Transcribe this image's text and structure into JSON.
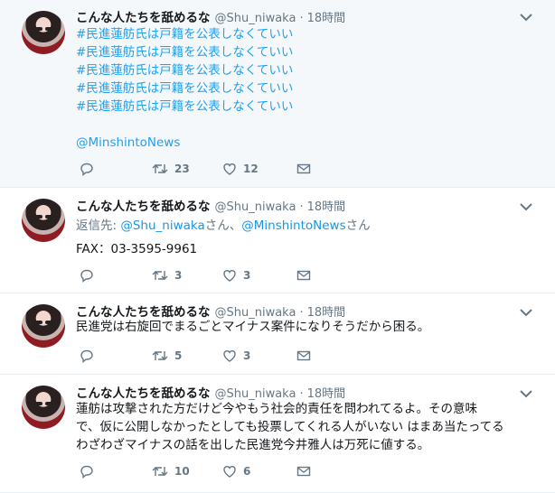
{
  "tweets": [
    {
      "name": "こんな人たちを舐めるな",
      "handle": "@Shu_niwaka",
      "time": "18時間",
      "lines": [
        "#民進蓮舫氏は戸籍を公表しなくていい",
        "#民進蓮舫氏は戸籍を公表しなくていい",
        "#民進蓮舫氏は戸籍を公表しなくていい",
        "#民進蓮舫氏は戸籍を公表しなくていい",
        "#民進蓮舫氏は戸籍を公表しなくていい"
      ],
      "mention": "@MinshintoNews",
      "retweets": "23",
      "likes": "12"
    },
    {
      "name": "こんな人たちを舐めるな",
      "handle": "@Shu_niwaka",
      "time": "18時間",
      "reply_prefix": "返信先: ",
      "reply_to_1": "@Shu_niwaka",
      "reply_san_1": "さん、",
      "reply_to_2": "@MinshintoNews",
      "reply_san_2": "さん",
      "text": "FAX：03-3595-9961",
      "retweets": "3",
      "likes": "3"
    },
    {
      "name": "こんな人たちを舐めるな",
      "handle": "@Shu_niwaka",
      "time": "18時間",
      "text": "民進党は右旋回でまるごとマイナス案件になりそうだから困る。",
      "retweets": "5",
      "likes": "3"
    },
    {
      "name": "こんな人たちを舐めるな",
      "handle": "@Shu_niwaka",
      "time": "18時間",
      "lines": [
        "蓮舫は攻撃された方だけど今やもう社会的責任を問われてるよ。その意味",
        "で、仮に公開しなかったとしても投票してくれる人がいない はまあ当たってる",
        "わざわざマイナスの話を出した民進党今井雅人は万死に値する。"
      ],
      "retweets": "10",
      "likes": "6"
    }
  ],
  "icons": [
    "reply-icon",
    "retweet-icon",
    "like-icon",
    "dm-icon",
    "chevron-down-icon"
  ],
  "colors": {
    "link": "#1da1f2",
    "muted": "#657786",
    "highlight_bg": "#f5f8fa"
  }
}
